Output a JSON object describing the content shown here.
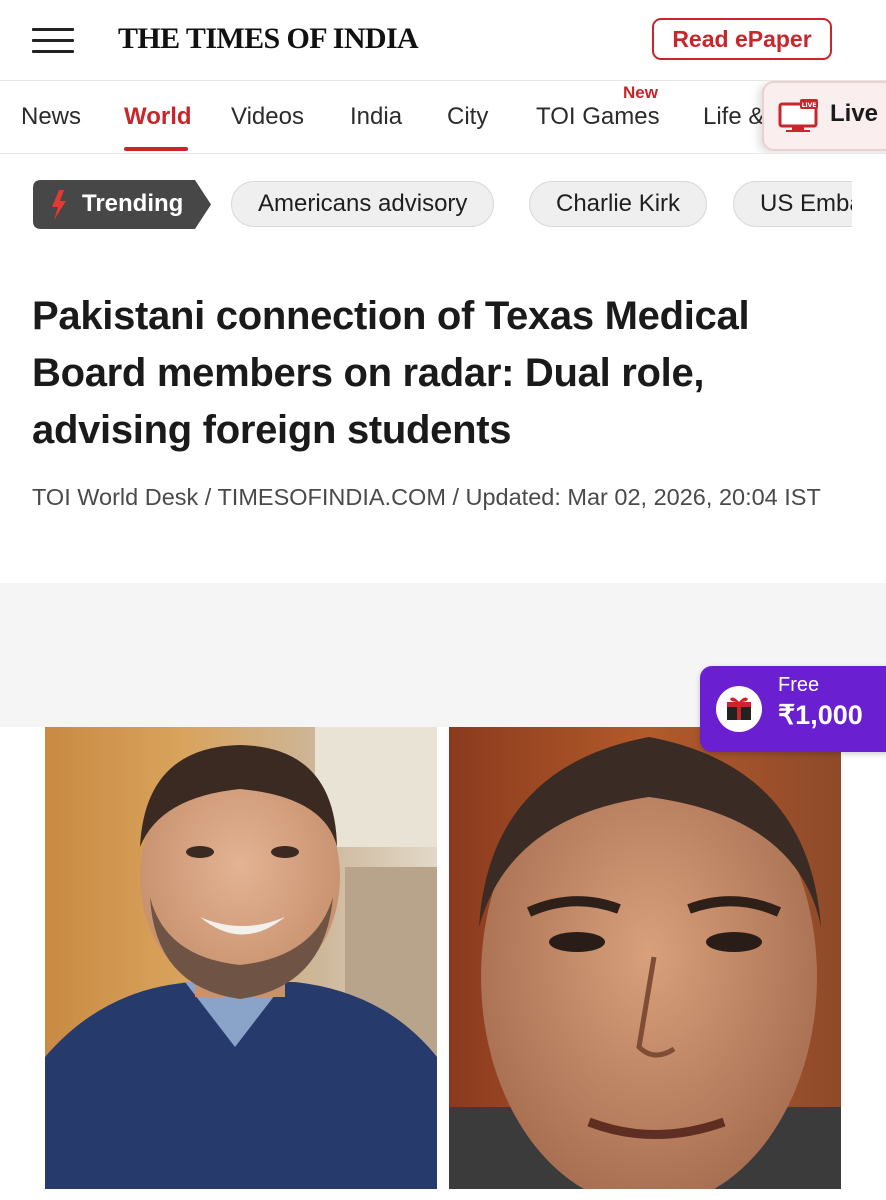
{
  "header": {
    "logo_text": "THE TIMES OF INDIA",
    "epaper_label": "Read ePaper",
    "accent_color": "#c8262b"
  },
  "nav": {
    "items": [
      {
        "label": "News"
      },
      {
        "label": "World"
      },
      {
        "label": "Videos"
      },
      {
        "label": "India"
      },
      {
        "label": "City"
      },
      {
        "label": "TOI Games"
      },
      {
        "label": "Life &"
      }
    ],
    "active": "World",
    "new_badge": "New",
    "live_label": "Live",
    "live_icon_text": "LIVE"
  },
  "trending": {
    "label": "Trending",
    "chips": [
      "Americans advisory",
      "Charlie Kirk",
      "US Emba"
    ]
  },
  "article": {
    "headline": "Pakistani connection of Texas Medical Board members on radar: Dual role, advising foreign students",
    "byline": "TOI World Desk / TIMESOFINDIA.COM / Updated: Mar 02, 2026, 20:04 IST"
  },
  "promo": {
    "label": "Free",
    "amount": "₹1,000",
    "color": "#6a1fd0"
  },
  "icons": [
    "hamburger-icon",
    "trending-bolt-icon",
    "live-tv-icon",
    "promo-logo-icon"
  ]
}
